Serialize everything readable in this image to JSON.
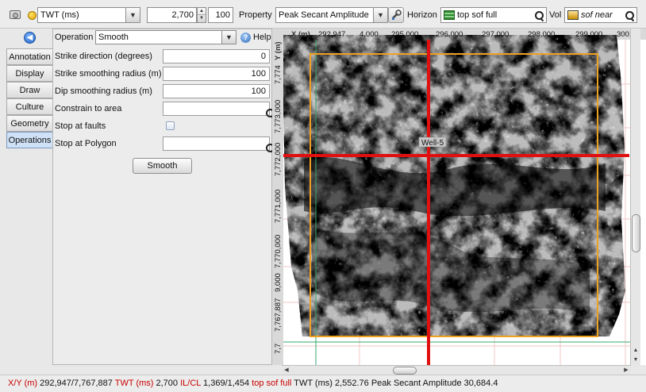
{
  "toolbar": {
    "domain_combo": "TWT (ms)",
    "value_field": "2,700",
    "step_field": "100",
    "property_label": "Property",
    "property_value": "Peak Secant Amplitude",
    "horizon_label": "Horizon",
    "horizon_value": "top sof full",
    "vol_label": "Vol",
    "vol_value": "sof near",
    "icons": [
      "camera-icon",
      "status-dot-icon",
      "wrench-icon",
      "grid-icon",
      "volume-icon",
      "search-icon"
    ]
  },
  "tabs": [
    {
      "label": "Annotation",
      "active": false
    },
    {
      "label": "Display",
      "active": false
    },
    {
      "label": "Draw",
      "active": false
    },
    {
      "label": "Culture",
      "active": false
    },
    {
      "label": "Geometry",
      "active": false
    },
    {
      "label": "Operations",
      "active": true
    }
  ],
  "panel": {
    "operation_label": "Operation",
    "operation_value": "Smooth",
    "help_label": "Help",
    "strike_dir_label": "Strike direction (degrees)",
    "strike_dir_value": "0",
    "strike_radius_label": "Strike smoothing radius (m)",
    "strike_radius_value": "100",
    "dip_radius_label": "Dip smoothing radius (m)",
    "dip_radius_value": "100",
    "constrain_label": "Constrain to area",
    "stop_faults_label": "Stop at faults",
    "stop_polygon_label": "Stop at Polygon",
    "smooth_button": "Smooth"
  },
  "map": {
    "x_axis_label": "X (m)",
    "y_axis_label": "Y (m)",
    "x_ticks": [
      "292,947",
      "4,000",
      "295,000",
      "296,000",
      "297,000",
      "298,000",
      "299,000",
      "300,"
    ],
    "y_ticks": [
      "7,774",
      "7,773,000",
      "7,772,000",
      "7,771,000",
      "7,770,000",
      "9,000",
      "7,767,887",
      "7,7"
    ],
    "well_label": "Well-5",
    "colors": {
      "crosshair": "#e01010",
      "outline": "#f0a020",
      "grid": "#e89a9a"
    }
  },
  "status": {
    "xy_label": "X/Y (m)",
    "xy_value": "292,947/7,767,887",
    "twt_label": "TWT (ms)",
    "twt_value": "2,700",
    "ilcl_label": "IL/CL",
    "ilcl_value": "1,369/1,454",
    "horizon_name": "top sof full",
    "horizon_info": "TWT (ms) 2,552.76 Peak Secant Amplitude 30,684.4"
  }
}
